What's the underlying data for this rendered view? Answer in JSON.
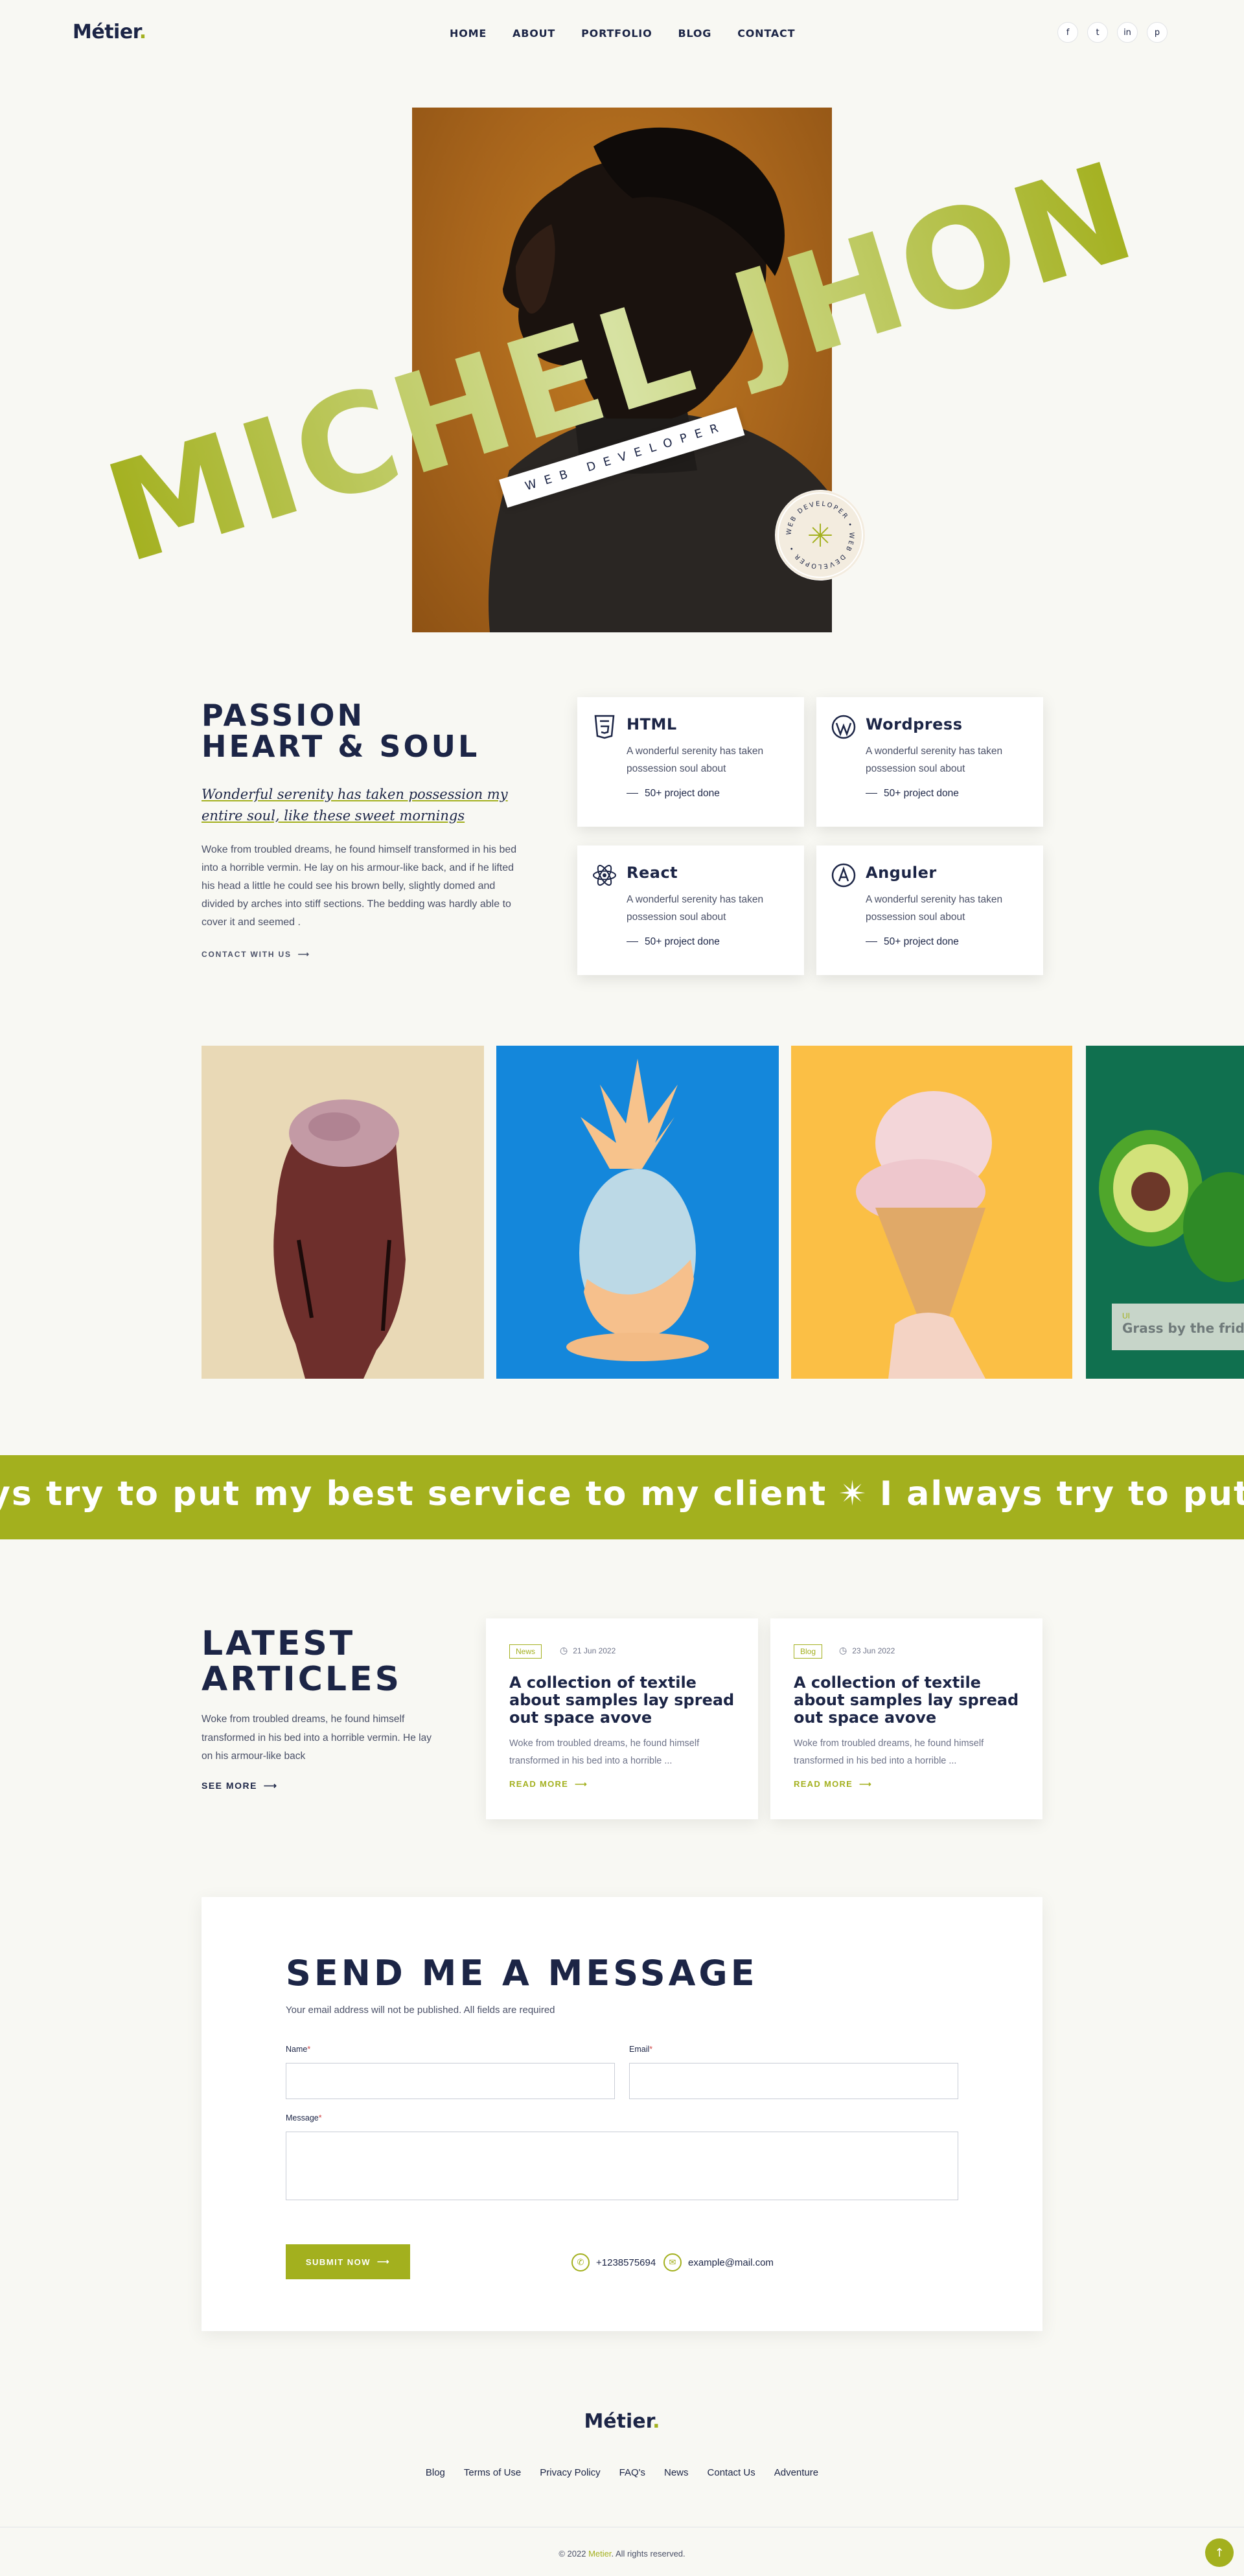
{
  "header": {
    "logo": "Métier",
    "logo_dot": ".",
    "nav": [
      "HOME",
      "ABOUT",
      "PORTFOLIO",
      "BLOG",
      "CONTACT"
    ],
    "socials": [
      {
        "icon": "facebook-icon",
        "glyph": "f"
      },
      {
        "icon": "twitter-icon",
        "glyph": "t"
      },
      {
        "icon": "linkedin-icon",
        "glyph": "in"
      },
      {
        "icon": "pinterest-icon",
        "glyph": "p"
      }
    ]
  },
  "hero": {
    "name": "MICHEL JHON",
    "role": "WEB DEVELOPER",
    "badge_text": "WEB DEVELOPER • WEB DEVELOPER • ",
    "name_color": "#a3b01e"
  },
  "passion": {
    "title_line1": "PASSION",
    "title_line2": "HEART & SOUL",
    "subtitle": "Wonderful serenity has taken possession my entire soul, like these sweet mornings",
    "body": "Woke from troubled dreams, he found himself transformed in his bed into a horrible vermin. He lay on his armour-like back, and if he lifted his head a little he could see his brown belly, slightly domed and divided by arches into stiff sections. The bedding was hardly able to cover it and seemed .",
    "contact_link": "CONTACT WITH US",
    "cards": [
      {
        "icon": "html5-icon",
        "title": "HTML",
        "desc": "A wonderful serenity has taken possession soul about",
        "projects": "50+ project done"
      },
      {
        "icon": "wordpress-icon",
        "title": "Wordpress",
        "desc": "A wonderful serenity has taken possession soul about",
        "projects": "50+ project done"
      },
      {
        "icon": "react-icon",
        "title": "React",
        "desc": "A wonderful serenity has taken possession soul about",
        "projects": "50+ project done"
      },
      {
        "icon": "angular-icon",
        "title": "Anguler",
        "desc": "A wonderful serenity has taken possession soul about",
        "projects": "50+ project done"
      }
    ]
  },
  "gallery": {
    "items": [
      "brain-sculpture-image",
      "pineapple-image",
      "ice-cream-image",
      "avocado-image"
    ],
    "overlay_tag": "UI",
    "overlay_caption": "Grass by the fridge"
  },
  "marquee": {
    "part1": "ys try to put my best service to my client",
    "star": "✴",
    "part2": "I always try to put"
  },
  "articles": {
    "title_line1": "LATEST",
    "title_line2": "ARTICLES",
    "desc": "Woke from troubled dreams, he found himself transformed in his bed into a horrible vermin. He lay on his armour-like back",
    "see_more": "SEE MORE",
    "items": [
      {
        "tag": "News",
        "date": "21 Jun 2022",
        "title": "A collection of textile about samples lay spread out space avove",
        "excerpt": "Woke from troubled dreams, he found himself transformed in his bed into a horrible ...",
        "read_more": "READ MORE"
      },
      {
        "tag": "Blog",
        "date": "23 Jun 2022",
        "title": "A collection of textile about samples lay spread out space avove",
        "excerpt": "Woke from troubled dreams, he found himself transformed in his bed into a horrible ...",
        "read_more": "READ MORE"
      }
    ]
  },
  "contact": {
    "title": "SEND ME A MESSAGE",
    "subtitle": "Your email address will not be published. All fields are required",
    "name_label": "Name",
    "email_label": "Email",
    "message_label": "Message",
    "required_mark": "*",
    "name_value": "",
    "email_value": "",
    "message_value": "",
    "submit": "SUBMIT NOW",
    "phone": "+1238575694",
    "email": "example@mail.com"
  },
  "footer": {
    "logo": "Métier",
    "logo_dot": ".",
    "links": [
      "Blog",
      "Terms of Use",
      "Privacy Policy",
      "FAQ's",
      "News",
      "Contact Us",
      "Adventure"
    ],
    "copy_prefix": "© 2022 ",
    "copy_brand": "Metier",
    "copy_suffix": ". All rights reserved.",
    "to_top": "↑"
  },
  "colors": {
    "accent": "#a3b01e",
    "navy": "#1c2546",
    "background": "#f8f8f3"
  }
}
